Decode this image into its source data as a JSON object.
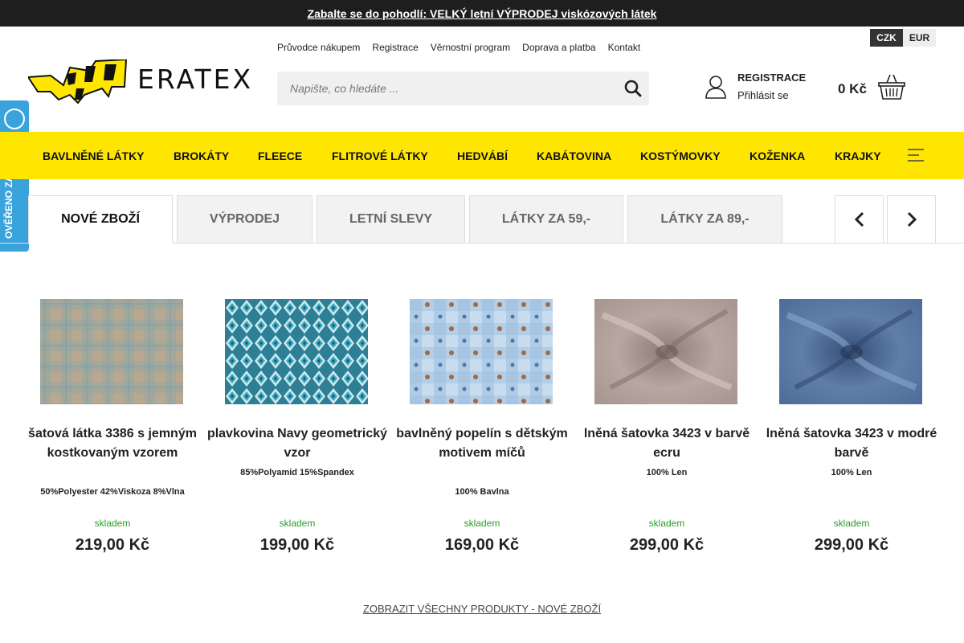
{
  "promo": {
    "text": "Zabalte se do pohodlí: VELKÝ letní VÝPRODEJ viskózových látek"
  },
  "header": {
    "logo_text": "ERATEX",
    "top_links": [
      "Průvodce nákupem",
      "Registrace",
      "Věrnostní program",
      "Doprava a platba",
      "Kontakt"
    ],
    "search_placeholder": "Napište, co hledáte ...",
    "currency": {
      "active": "CZK",
      "other": "EUR"
    },
    "account": {
      "register": "REGISTRACE",
      "login": "Přihlásit se"
    },
    "cart": {
      "total": "0 Kč"
    }
  },
  "verified_badge": {
    "label": "OVĚŘENO ZÁKAZNÍKY"
  },
  "nav": {
    "items": [
      "BAVLNĚNÉ LÁTKY",
      "BROKÁTY",
      "FLEECE",
      "FLITROVÉ LÁTKY",
      "HEDVÁBÍ",
      "KABÁTOVINA",
      "KOSTÝMOVKY",
      "KOŽENKA",
      "KRAJKY"
    ]
  },
  "tabs": [
    "NOVÉ ZBOŽÍ",
    "VÝPRODEJ",
    "LETNÍ SLEVY",
    "LÁTKY ZA 59,-",
    "LÁTKY ZA 89,-"
  ],
  "products": [
    {
      "name": "šatová látka 3386 s jemným kostkovaným vzorem",
      "composition": "50%Polyester 42%Viskoza 8%Vlna",
      "stock": "skladem",
      "price": "219,00 Kč",
      "image": "tweed-check-fabric"
    },
    {
      "name": "plavkovina Navy geometrický vzor",
      "composition": "85%Polyamid 15%Spandex",
      "stock": "skladem",
      "price": "199,00 Kč",
      "image": "geometric-swimwear-fabric"
    },
    {
      "name": "bavlněný popelín s dětským motivem míčů",
      "composition": "100% Bavlna",
      "stock": "skladem",
      "price": "169,00 Kč",
      "image": "ball-print-poplin"
    },
    {
      "name": "lněná šatovka 3423 v barvě ecru",
      "composition": "100% Len",
      "stock": "skladem",
      "price": "299,00 Kč",
      "image": "ecru-linen-drape"
    },
    {
      "name": "lněná šatovka 3423 v modré barvě",
      "composition": "100% Len",
      "stock": "skladem",
      "price": "299,00 Kč",
      "image": "blue-linen-drape"
    }
  ],
  "show_all": "ZOBRAZIT VŠECHNY PRODUKTY - NOVÉ ZBOŽÍ",
  "colors": {
    "nav_bg": "#ffe600",
    "promo_bg": "#1e1e1e",
    "badge_bg": "#3aa3dc",
    "stock_green": "#2a9d2a"
  }
}
